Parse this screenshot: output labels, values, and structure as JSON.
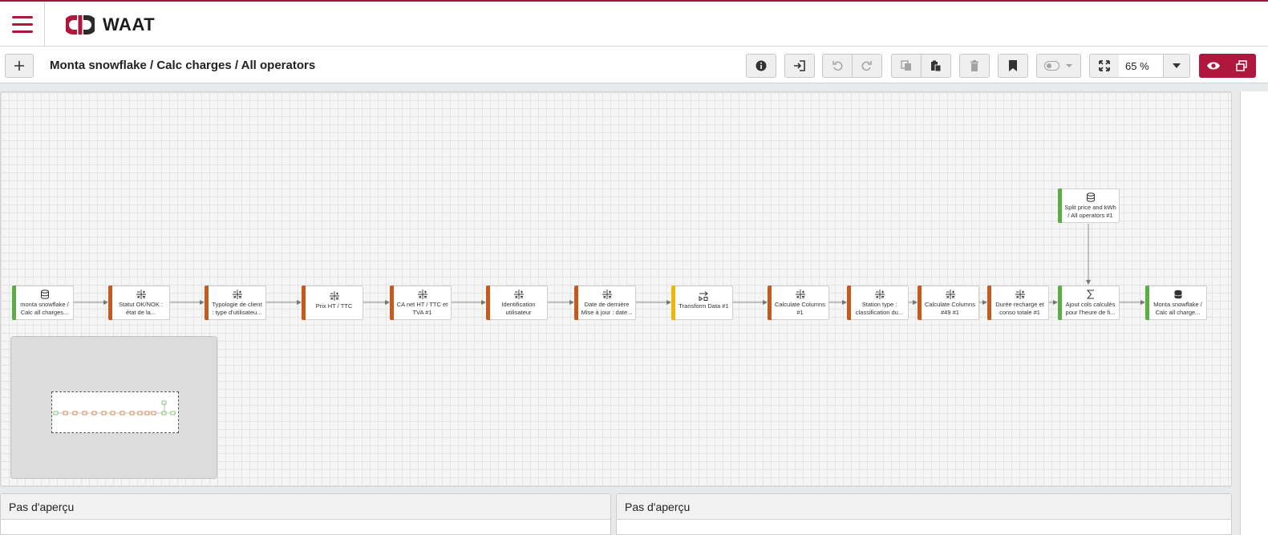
{
  "app": {
    "name": "WAAT"
  },
  "toolbar": {
    "breadcrumb": "Monta snowflake / Calc charges / All operators",
    "zoom_value": "65 %"
  },
  "colors": {
    "brand": "#b0173d",
    "source_node": "#5cad46",
    "transform_node": "#c45a1c",
    "transform_data_node": "#f0b700",
    "output_node": "#5cad46"
  },
  "nodes": [
    {
      "label": "monta snowflake / Calc all charges...",
      "icon": "database-icon",
      "kind": "source"
    },
    {
      "label": "Statut OK/NOK : état de la...",
      "icon": "calculator-icon",
      "kind": "transform"
    },
    {
      "label": "Typologie de client : type d'utilisateu...",
      "icon": "calculator-icon",
      "kind": "transform"
    },
    {
      "label": "Prix HT / TTC",
      "icon": "calculator-icon",
      "kind": "transform"
    },
    {
      "label": "CA net HT / TTC et TVA #1",
      "icon": "calculator-icon",
      "kind": "transform"
    },
    {
      "label": "Identification utilisateur",
      "icon": "calculator-icon",
      "kind": "transform"
    },
    {
      "label": "Date de dernière Mise à jour : date...",
      "icon": "calculator-icon",
      "kind": "transform"
    },
    {
      "label": "Transform Data #1",
      "icon": "transform-data-icon",
      "kind": "transform-data"
    },
    {
      "label": "Calculate Columns #1",
      "icon": "calculator-icon",
      "kind": "transform"
    },
    {
      "label": "Station type : classification du...",
      "icon": "calculator-icon",
      "kind": "transform"
    },
    {
      "label": "Calculate Columns #49 #1",
      "icon": "calculator-icon",
      "kind": "transform"
    },
    {
      "label": "Durée recharge et conso totale #1",
      "icon": "calculator-icon",
      "kind": "transform"
    },
    {
      "label": "Ajout cols calculés pour l'heure de fi...",
      "icon": "sigma-icon",
      "kind": "aggregate"
    },
    {
      "label": "Monta snowflake / Calc all charge...",
      "icon": "database-filled-icon",
      "kind": "output"
    },
    {
      "label": "Split price and kWh / All operators #1",
      "icon": "database-icon",
      "kind": "source"
    }
  ],
  "panels": {
    "left_title": "Pas d'aperçu",
    "right_title": "Pas d'aperçu"
  }
}
